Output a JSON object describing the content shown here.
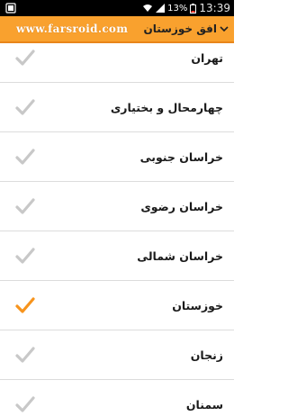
{
  "status_bar": {
    "battery_percent": "13%",
    "time": "13:39"
  },
  "action_bar": {
    "brand": "www.farsroid.com",
    "title": "افق خوزستان"
  },
  "colors": {
    "accent": "#f9a12e",
    "check_selected": "#f7941d",
    "check_unselected": "#c8c8c8"
  },
  "provinces": [
    {
      "label": "تهران",
      "selected": false
    },
    {
      "label": "چهارمحال و بختیاری",
      "selected": false
    },
    {
      "label": "خراسان جنوبی",
      "selected": false
    },
    {
      "label": "خراسان رضوی",
      "selected": false
    },
    {
      "label": "خراسان شمالی",
      "selected": false
    },
    {
      "label": "خوزستان",
      "selected": true
    },
    {
      "label": "زنجان",
      "selected": false
    },
    {
      "label": "سمنان",
      "selected": false
    }
  ]
}
